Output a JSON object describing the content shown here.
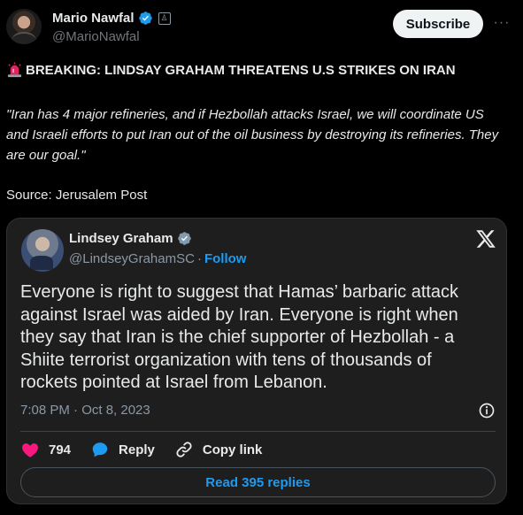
{
  "post": {
    "author_name": "Mario Nawfal",
    "author_handle": "@MarioNawfal",
    "subscribe_label": "Subscribe",
    "more_label": "···",
    "headline": "BREAKING: LINDSAY GRAHAM THREATENS U.S STRIKES ON IRAN",
    "quote": "\"Iran has 4 major refineries, and if Hezbollah attacks Israel, we will coordinate US and Israeli efforts to put Iran out of the oil business by destroying its refineries. They are our goal.\"",
    "source": "Source: Jerusalem Post"
  },
  "embed": {
    "author_name": "Lindsey Graham",
    "author_handle": "@LindseyGrahamSC",
    "separator": "·",
    "follow_label": "Follow",
    "text": "Everyone is right to suggest that Hamas’ barbaric attack against Israel was aided by Iran. Everyone is right when they say that Iran is the chief supporter of Hezbollah - a Shiite terrorist organization with tens of thousands of rockets pointed at Israel from Lebanon.",
    "timestamp": "7:08 PM · Oct 8, 2023",
    "likes": "794",
    "reply_label": "Reply",
    "copy_link_label": "Copy link",
    "read_replies_label": "Read 395 replies"
  },
  "colors": {
    "background": "#000000",
    "card_background": "#1e1e1e",
    "accent_blue": "#1d9bf0",
    "like_pink": "#f91880",
    "muted_text": "#71767b"
  }
}
